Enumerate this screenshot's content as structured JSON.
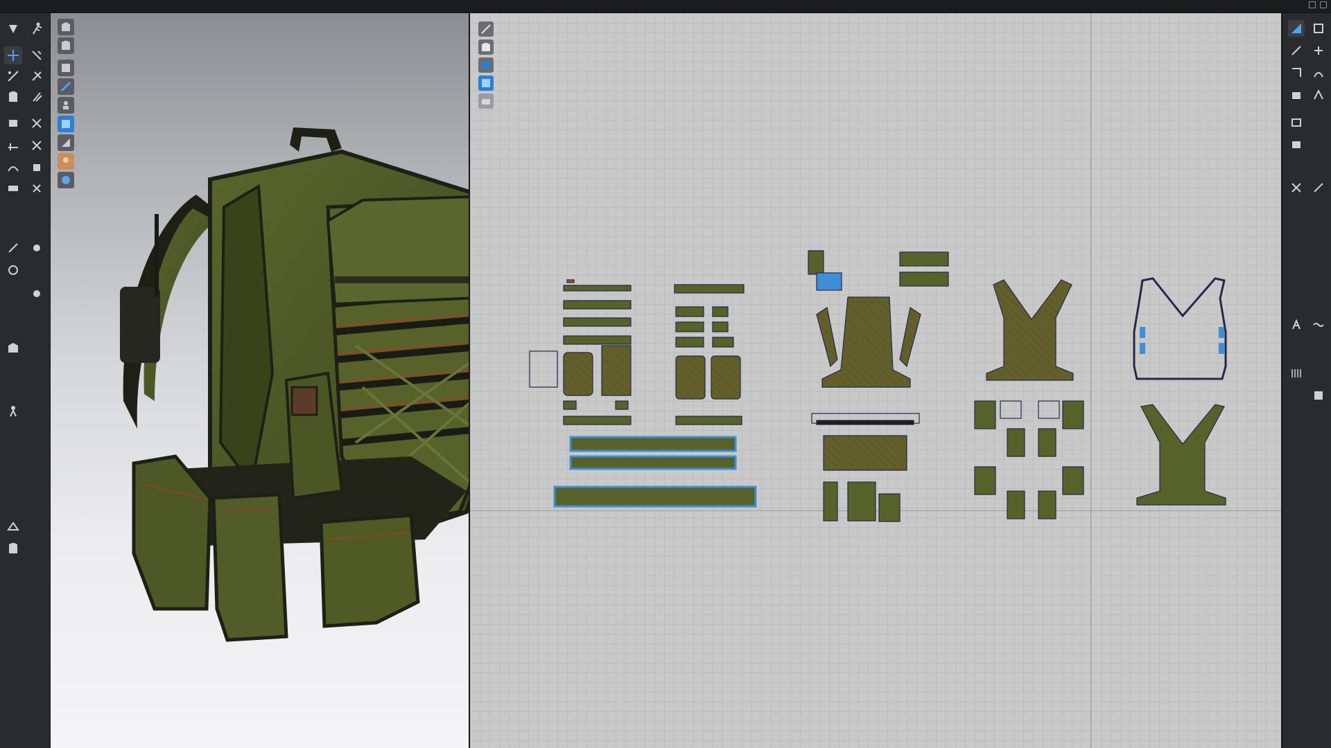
{
  "window": {
    "controls": [
      "restore-icon",
      "maximize-icon"
    ]
  },
  "left_toolbar": {
    "icons": [
      "move-icon",
      "run-icon",
      "transform-icon",
      "pin-icon",
      "edit-pattern-icon",
      "select-icon",
      "garment-icon",
      "brush-icon",
      "fold-icon",
      "tuck-icon",
      "sew-icon",
      "cut-icon",
      "seam-icon",
      "stitch-icon",
      "line-icon",
      "point-icon",
      "button-icon",
      "zipper-icon",
      "elastic-icon",
      "tape-icon",
      "measure-icon",
      "avatar-icon",
      "hanger-icon",
      "shirt-icon"
    ]
  },
  "viewport_3d": {
    "tools": [
      "mannequin-icon",
      "shirt-display-icon",
      "fabric-icon",
      "texture-icon",
      "avatar-display-icon",
      "texture-mode-icon",
      "render-icon",
      "skin-icon",
      "globe-icon"
    ],
    "selected_tool": "texture-mode-icon",
    "colors": {
      "fabric": "#4f5a25",
      "strap": "#1e2016",
      "stitch": "#b2352a"
    }
  },
  "viewport_2d": {
    "tools": [
      "pencil-icon",
      "shirt-2d-icon",
      "info-icon",
      "texture-2d-icon",
      "layers-icon"
    ],
    "selected_tool": "texture-2d-icon",
    "colors": {
      "pattern_fill": "#56622a",
      "seam": "#c63b2d",
      "selected_outline": "#3e8fd6",
      "outline": "#23284a"
    }
  },
  "right_toolbar": {
    "icons": [
      "polygon-icon",
      "rectangle-icon",
      "ellipse-icon",
      "internal-line-icon",
      "dart-icon",
      "trace-icon",
      "fold-arrange-icon",
      "notch-icon",
      "segment-icon",
      "symmetry-icon",
      "offset-icon",
      "grade-icon",
      "text-icon",
      "annotation-icon",
      "ruler-icon",
      "grid-icon"
    ]
  }
}
